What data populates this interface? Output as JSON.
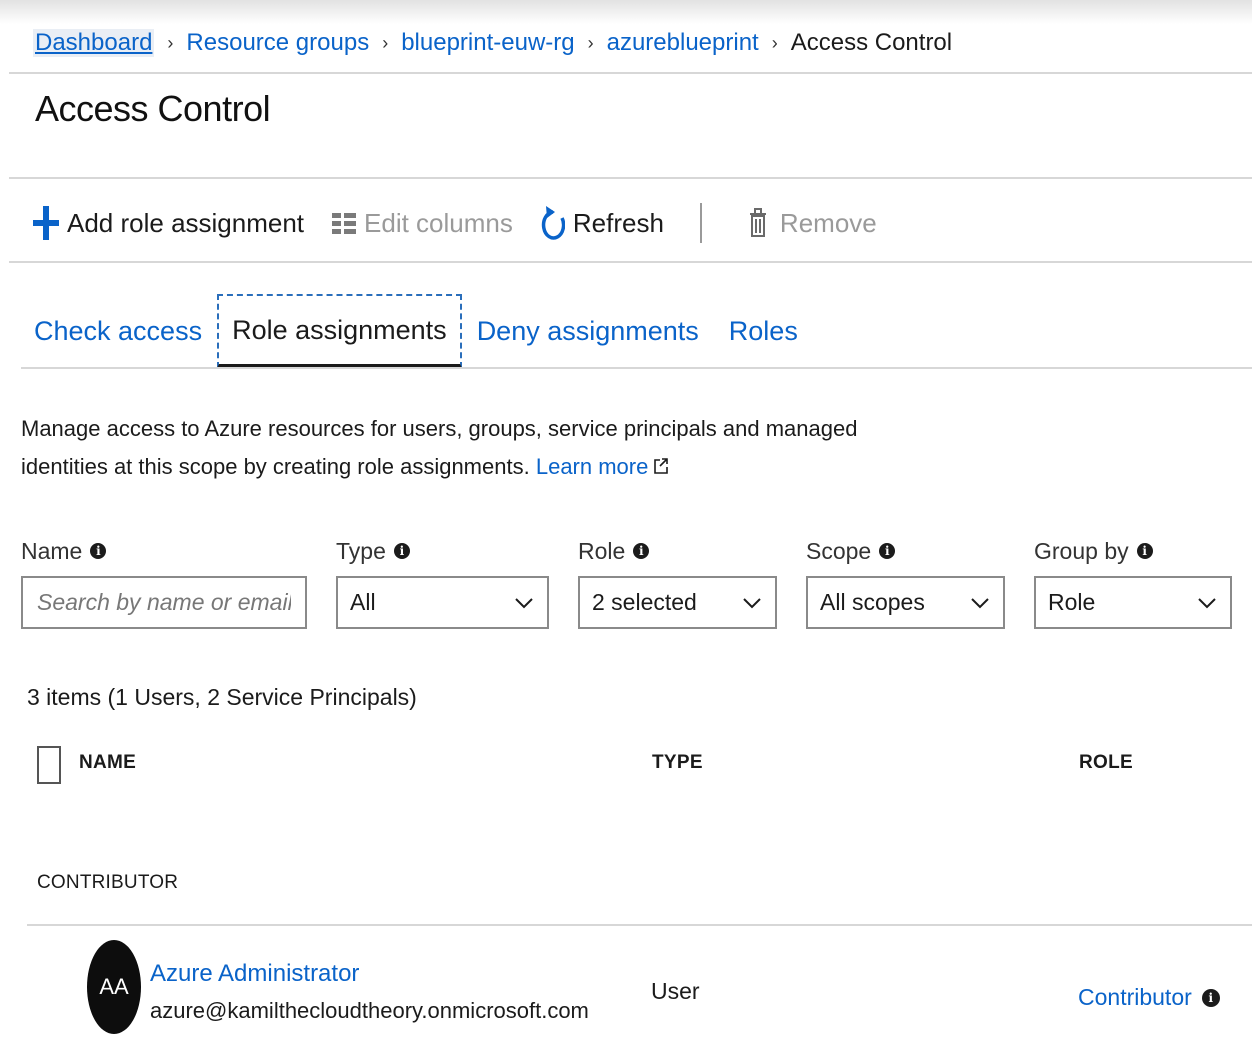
{
  "breadcrumb": {
    "items": [
      "Dashboard",
      "Resource groups",
      "blueprint-euw-rg",
      "azureblueprint"
    ],
    "current": "Access Control"
  },
  "page": {
    "title": "Access Control"
  },
  "toolbar": {
    "add_label": "Add role assignment",
    "edit_columns_label": "Edit columns",
    "refresh_label": "Refresh",
    "remove_label": "Remove"
  },
  "tabs": [
    {
      "label": "Check access",
      "active": false
    },
    {
      "label": "Role assignments",
      "active": true
    },
    {
      "label": "Deny assignments",
      "active": false
    },
    {
      "label": "Roles",
      "active": false
    }
  ],
  "description": {
    "text": "Manage access to Azure resources for users, groups, service principals and managed identities at this scope by creating role assignments.",
    "link_label": "Learn more"
  },
  "filters": {
    "name": {
      "label": "Name",
      "placeholder": "Search by name or email"
    },
    "type": {
      "label": "Type",
      "value": "All"
    },
    "role": {
      "label": "Role",
      "value": "2 selected"
    },
    "scope": {
      "label": "Scope",
      "value": "All scopes"
    },
    "group_by": {
      "label": "Group by",
      "value": "Role"
    }
  },
  "summary": "3 items (1 Users, 2 Service Principals)",
  "table": {
    "columns": [
      "NAME",
      "TYPE",
      "ROLE"
    ],
    "groups": [
      {
        "label": "CONTRIBUTOR",
        "rows": [
          {
            "initials": "AA",
            "name": "Azure Administrator",
            "email": "azure@kamilthecloudtheory.onmicrosoft.com",
            "type": "User",
            "role": "Contributor"
          }
        ]
      }
    ]
  },
  "colors": {
    "link": "#0a63c9",
    "text": "#1b1b1b",
    "disabled": "#9a9a9a",
    "avatar": "#0d0d0d"
  },
  "icons": {
    "add": "plus-icon",
    "edit_columns": "columns-icon",
    "refresh": "refresh-icon",
    "remove": "trash-icon",
    "external": "external-link-icon",
    "info": "info-icon",
    "dropdown": "chevron-down-icon"
  }
}
